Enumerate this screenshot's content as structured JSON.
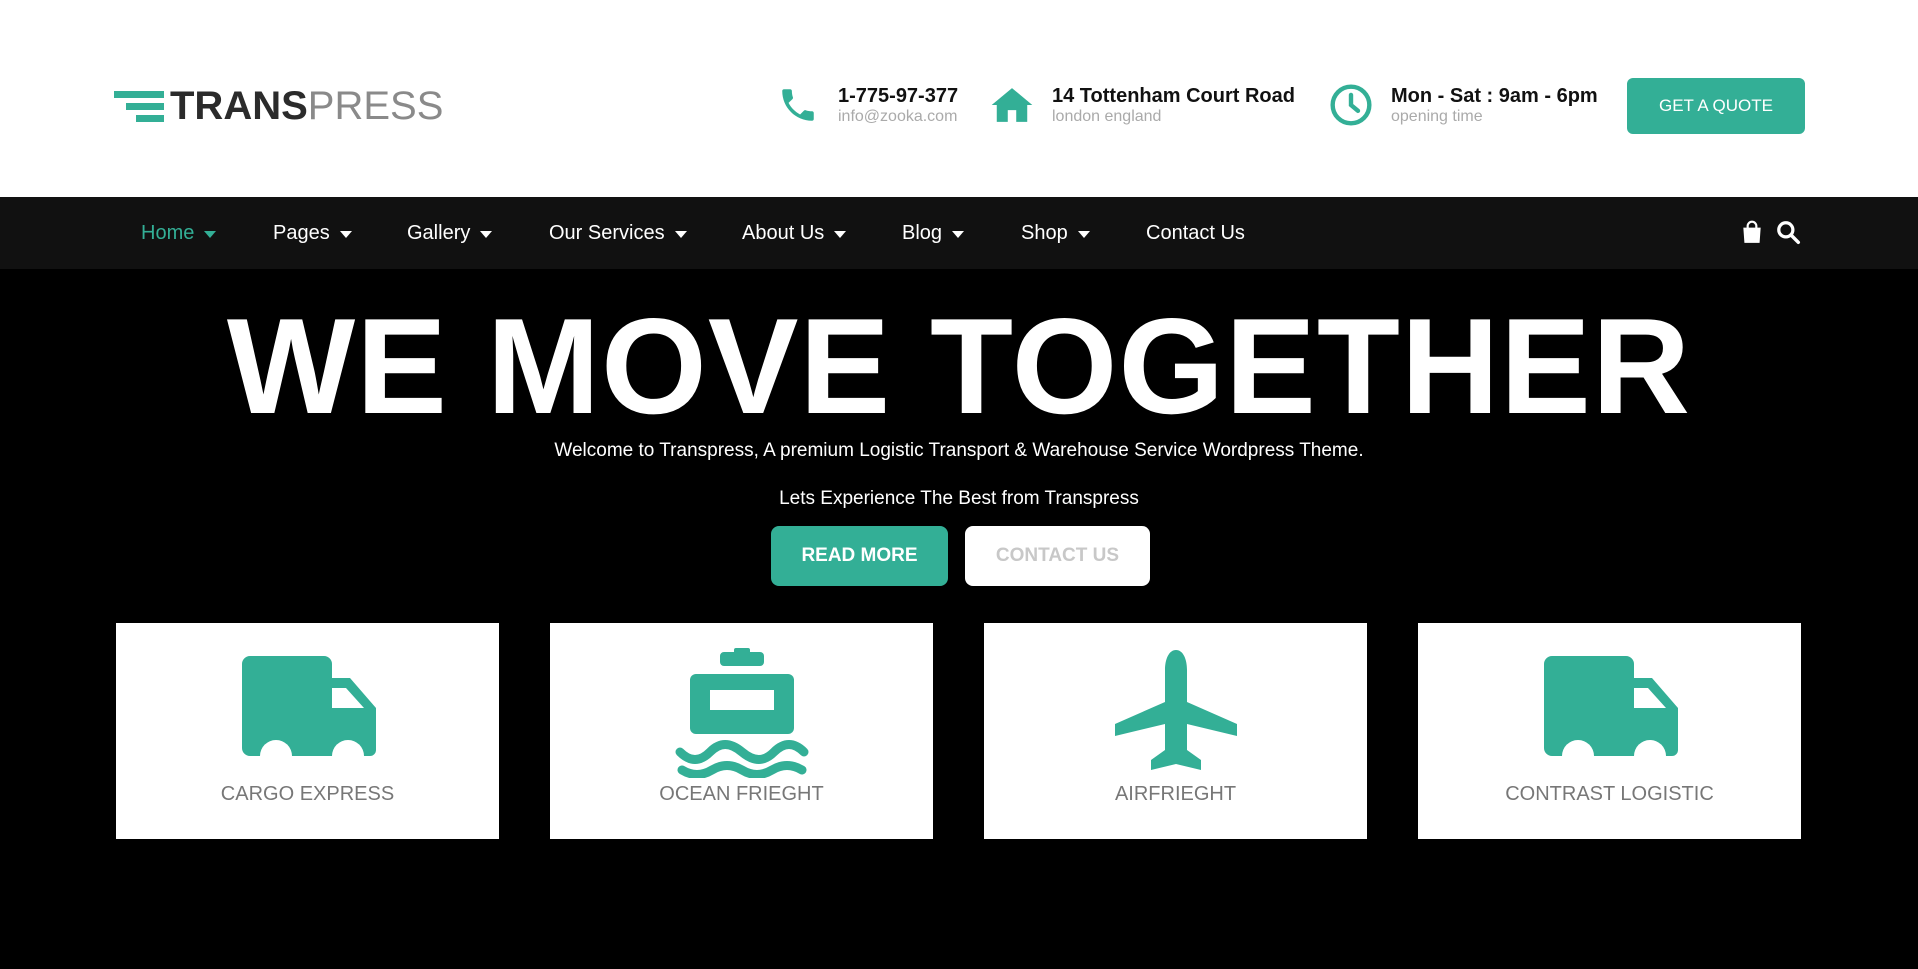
{
  "brand": {
    "name_bold": "TRANS",
    "name_light": "PRESS",
    "accent": "#33af96"
  },
  "header": {
    "contacts": [
      {
        "icon": "phone-icon",
        "title": "1-775-97-377",
        "sub": "info@zooka.com"
      },
      {
        "icon": "home-icon",
        "title": "14 Tottenham Court Road",
        "sub": "london england"
      },
      {
        "icon": "clock-icon",
        "title": "Mon - Sat : 9am - 6pm",
        "sub": "opening time"
      }
    ],
    "quote_label": "GET A QUOTE"
  },
  "nav": {
    "items": [
      {
        "label": "Home",
        "active": true,
        "has_dropdown": true
      },
      {
        "label": "Pages",
        "has_dropdown": true
      },
      {
        "label": "Gallery",
        "has_dropdown": true
      },
      {
        "label": "Our Services",
        "has_dropdown": true
      },
      {
        "label": "About Us",
        "has_dropdown": true
      },
      {
        "label": "Blog",
        "has_dropdown": true
      },
      {
        "label": "Shop",
        "has_dropdown": true
      },
      {
        "label": "Contact Us",
        "has_dropdown": false
      }
    ],
    "icons": [
      "shopping-bag-icon",
      "search-icon"
    ]
  },
  "hero": {
    "title": "WE MOVE TOGETHER",
    "subtitle": "Welcome to Transpress, A premium Logistic Transport & Warehouse Service Wordpress Theme.",
    "tagline": "Lets Experience The Best from Transpress",
    "read_more": "READ MORE",
    "contact_us": "CONTACT US"
  },
  "services": [
    {
      "icon": "truck-icon",
      "label": "CARGO EXPRESS"
    },
    {
      "icon": "ship-icon",
      "label": "OCEAN FRIEGHT"
    },
    {
      "icon": "plane-icon",
      "label": "AIRFRIEGHT"
    },
    {
      "icon": "truck-icon",
      "label": "CONTRAST LOGISTIC"
    }
  ]
}
